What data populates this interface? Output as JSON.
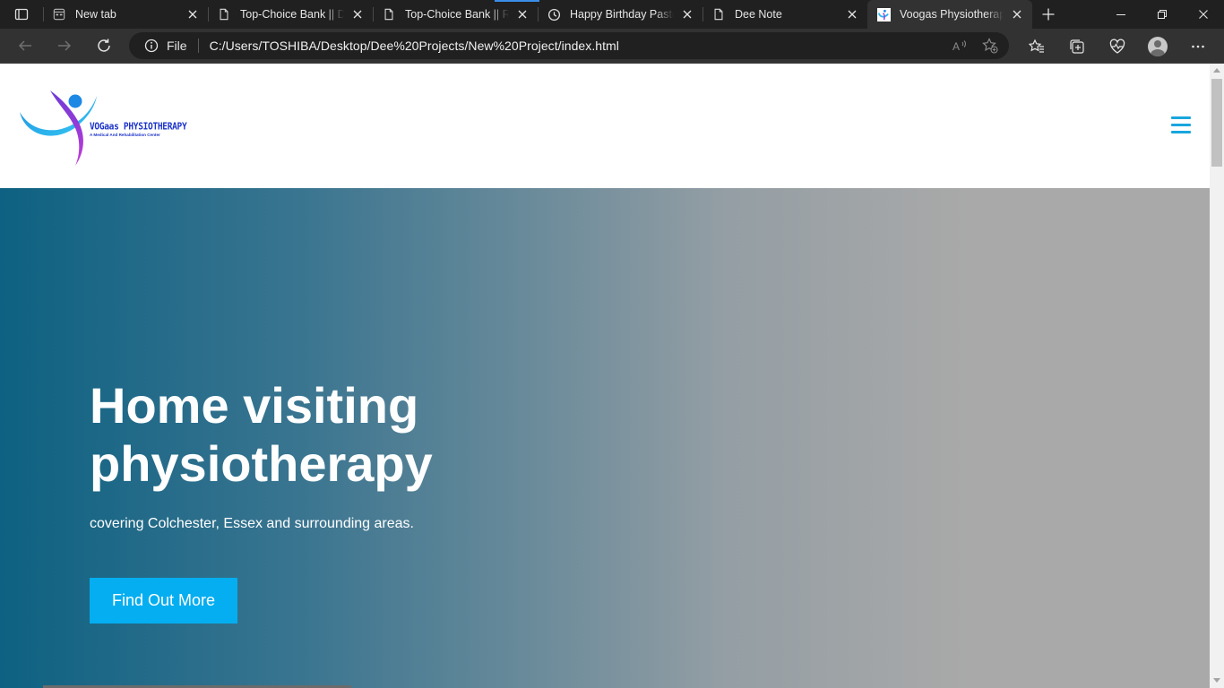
{
  "browser": {
    "tabs": [
      {
        "title": "New tab",
        "icon": "new-tab-page-icon"
      },
      {
        "title": "Top-Choice Bank || Dashboard",
        "icon": "file-icon"
      },
      {
        "title": "Top-Choice Bank || Register",
        "icon": "file-icon"
      },
      {
        "title": "Happy Birthday Pastor",
        "icon": "clock-icon"
      },
      {
        "title": "Dee Note",
        "icon": "file-icon"
      },
      {
        "title": "Voogas Physiotherapy",
        "icon": "site-logo-icon",
        "active": true
      }
    ],
    "address": {
      "scheme_label": "File",
      "url": "C:/Users/TOSHIBA/Desktop/Dee%20Projects/New%20Project/index.html"
    }
  },
  "site": {
    "logo": {
      "name": "VOGaas PHYSIOTHERAPY",
      "tagline": "A Medical And Rehabilitation Center"
    },
    "hero": {
      "title": "Home visiting physiotherapy",
      "subtitle": "covering Colchester, Essex and surrounding areas.",
      "cta_label": "Find Out More"
    }
  },
  "colors": {
    "accent": "#05aef0",
    "hamburger": "#18a6dd",
    "hero_gradient_start": "#0e6182",
    "hero_gradient_end": "#a9a9a9",
    "browser_chrome": "#202020"
  }
}
